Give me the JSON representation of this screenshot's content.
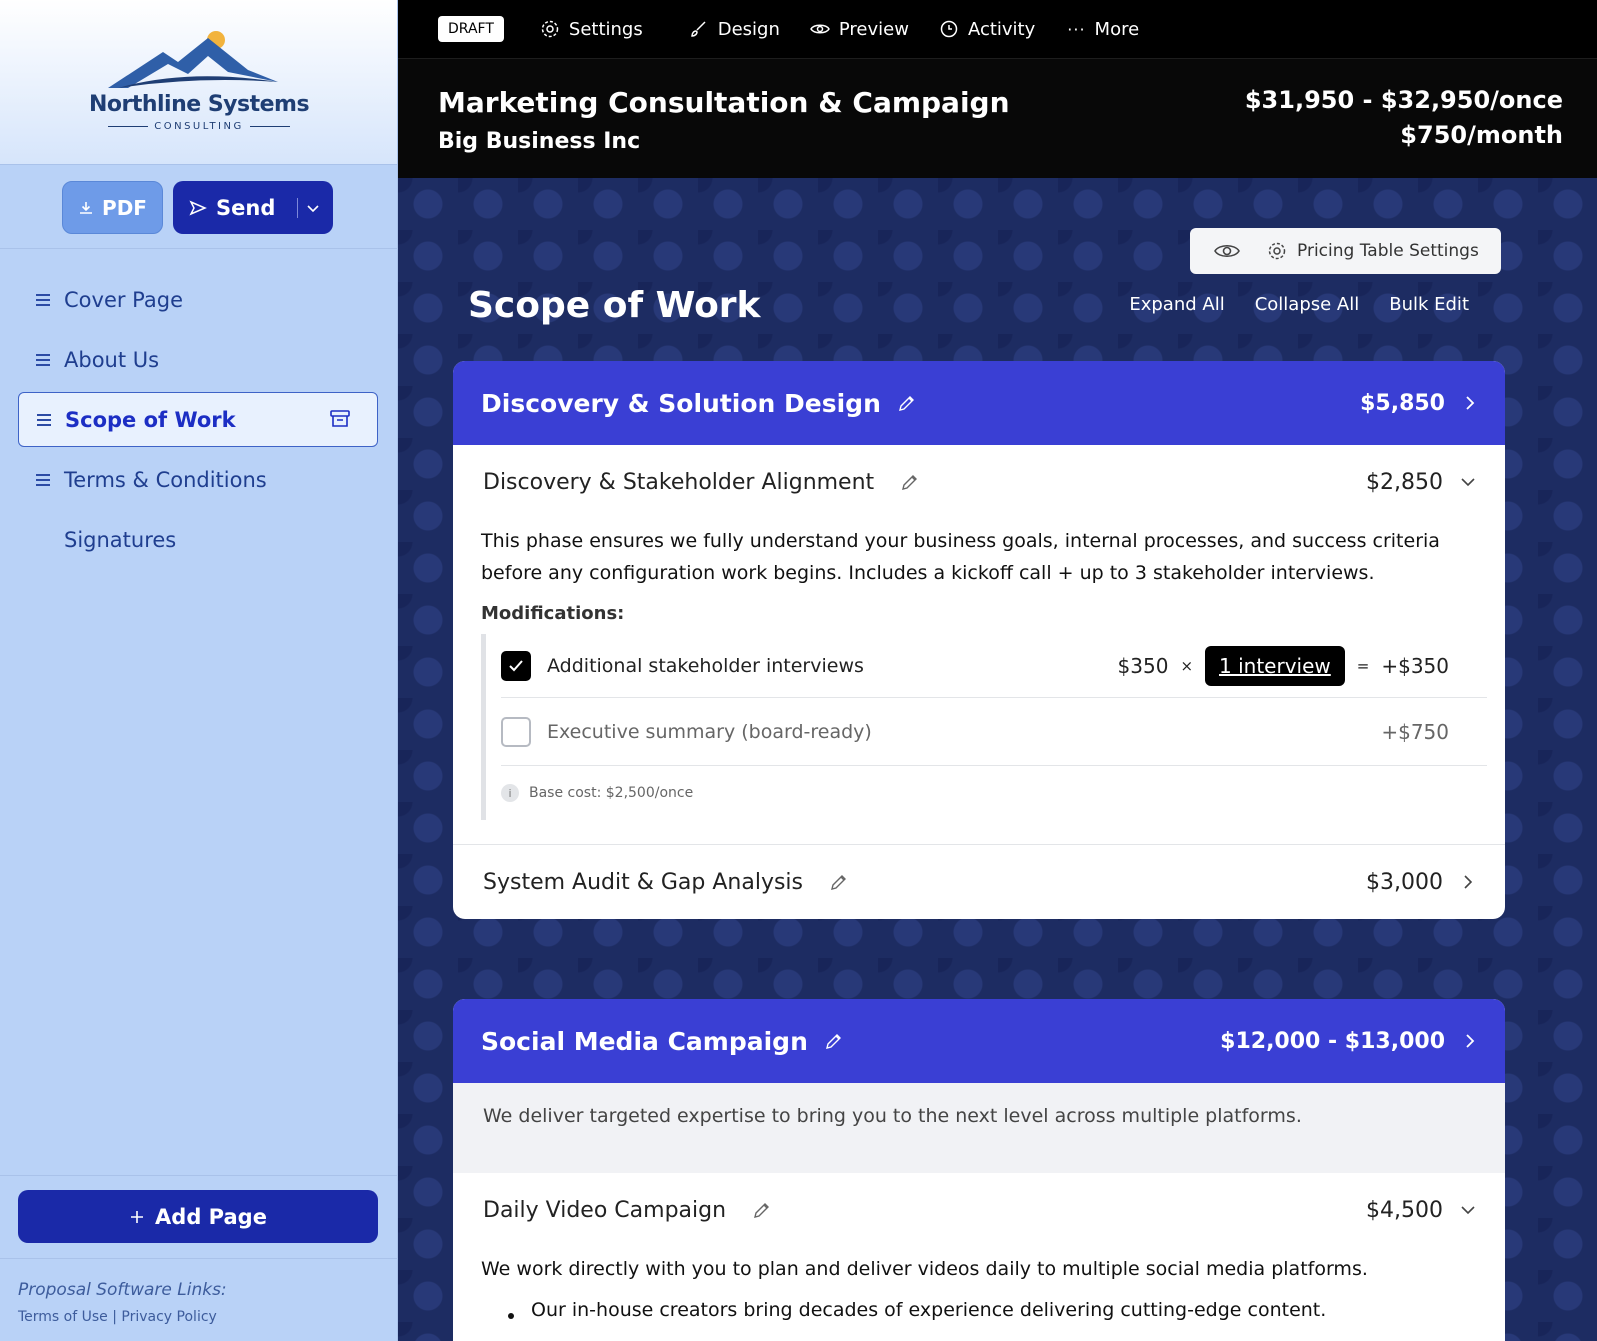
{
  "sidebar": {
    "logo": {
      "name": "Northline Systems",
      "sub": "CONSULTING"
    },
    "pdf_label": "PDF",
    "send_label": "Send",
    "nav": [
      {
        "label": "Cover Page"
      },
      {
        "label": "About Us"
      },
      {
        "label": "Scope of Work"
      },
      {
        "label": "Terms & Conditions"
      },
      {
        "label": "Signatures"
      }
    ],
    "add_page_label": "Add Page",
    "links_title": "Proposal Software Links:",
    "links": {
      "terms": "Terms of Use",
      "privacy": "Privacy Policy",
      "sep": "|"
    }
  },
  "topbar": {
    "status": "DRAFT",
    "items": [
      "Settings",
      "Design",
      "Preview",
      "Activity",
      "More"
    ]
  },
  "header": {
    "title": "Marketing Consultation & Campaign",
    "client": "Big Business Inc",
    "price_once": "$31,950 - $32,950/once",
    "price_monthly": "$750/month"
  },
  "content": {
    "pricing_settings_label": "Pricing Table Settings",
    "section_title": "Scope of Work",
    "actions": [
      "Expand All",
      "Collapse All",
      "Bulk Edit"
    ],
    "cards": [
      {
        "title": "Discovery & Solution Design",
        "price": "$5,850",
        "items": [
          {
            "title": "Discovery & Stakeholder Alignment",
            "price": "$2,850",
            "description": "This phase ensures we fully understand your business goals, internal processes, and success criteria before any configuration work begins. Includes a kickoff call + up to 3 stakeholder interviews.",
            "modifications_label": "Modifications:",
            "modifications": [
              {
                "label": "Additional stakeholder interviews",
                "checked": true,
                "unit_price": "$350",
                "times": "×",
                "qty": "1 interview",
                "equals": "=",
                "total": "+$350"
              },
              {
                "label": "Executive summary (board-ready)",
                "checked": false,
                "total": "+$750"
              }
            ],
            "base_cost": "Base cost: $2,500/once"
          },
          {
            "title": "System Audit & Gap Analysis",
            "price": "$3,000"
          }
        ]
      },
      {
        "title": "Social Media Campaign",
        "price": "$12,000 - $13,000",
        "intro": "We deliver targeted expertise to bring you to the next level across multiple platforms.",
        "items": [
          {
            "title": "Daily Video Campaign",
            "price": "$4,500",
            "description": "We work directly with you to plan and deliver videos daily to multiple social media platforms.",
            "bullets": [
              "Our in-house creators bring decades of experience delivering cutting-edge content."
            ]
          }
        ]
      }
    ]
  },
  "colors": {
    "accent": "#3a3fd4",
    "sidebar_bg": "#b9d2f7",
    "primary_button": "#1a29a8",
    "topbar": "#000000"
  }
}
